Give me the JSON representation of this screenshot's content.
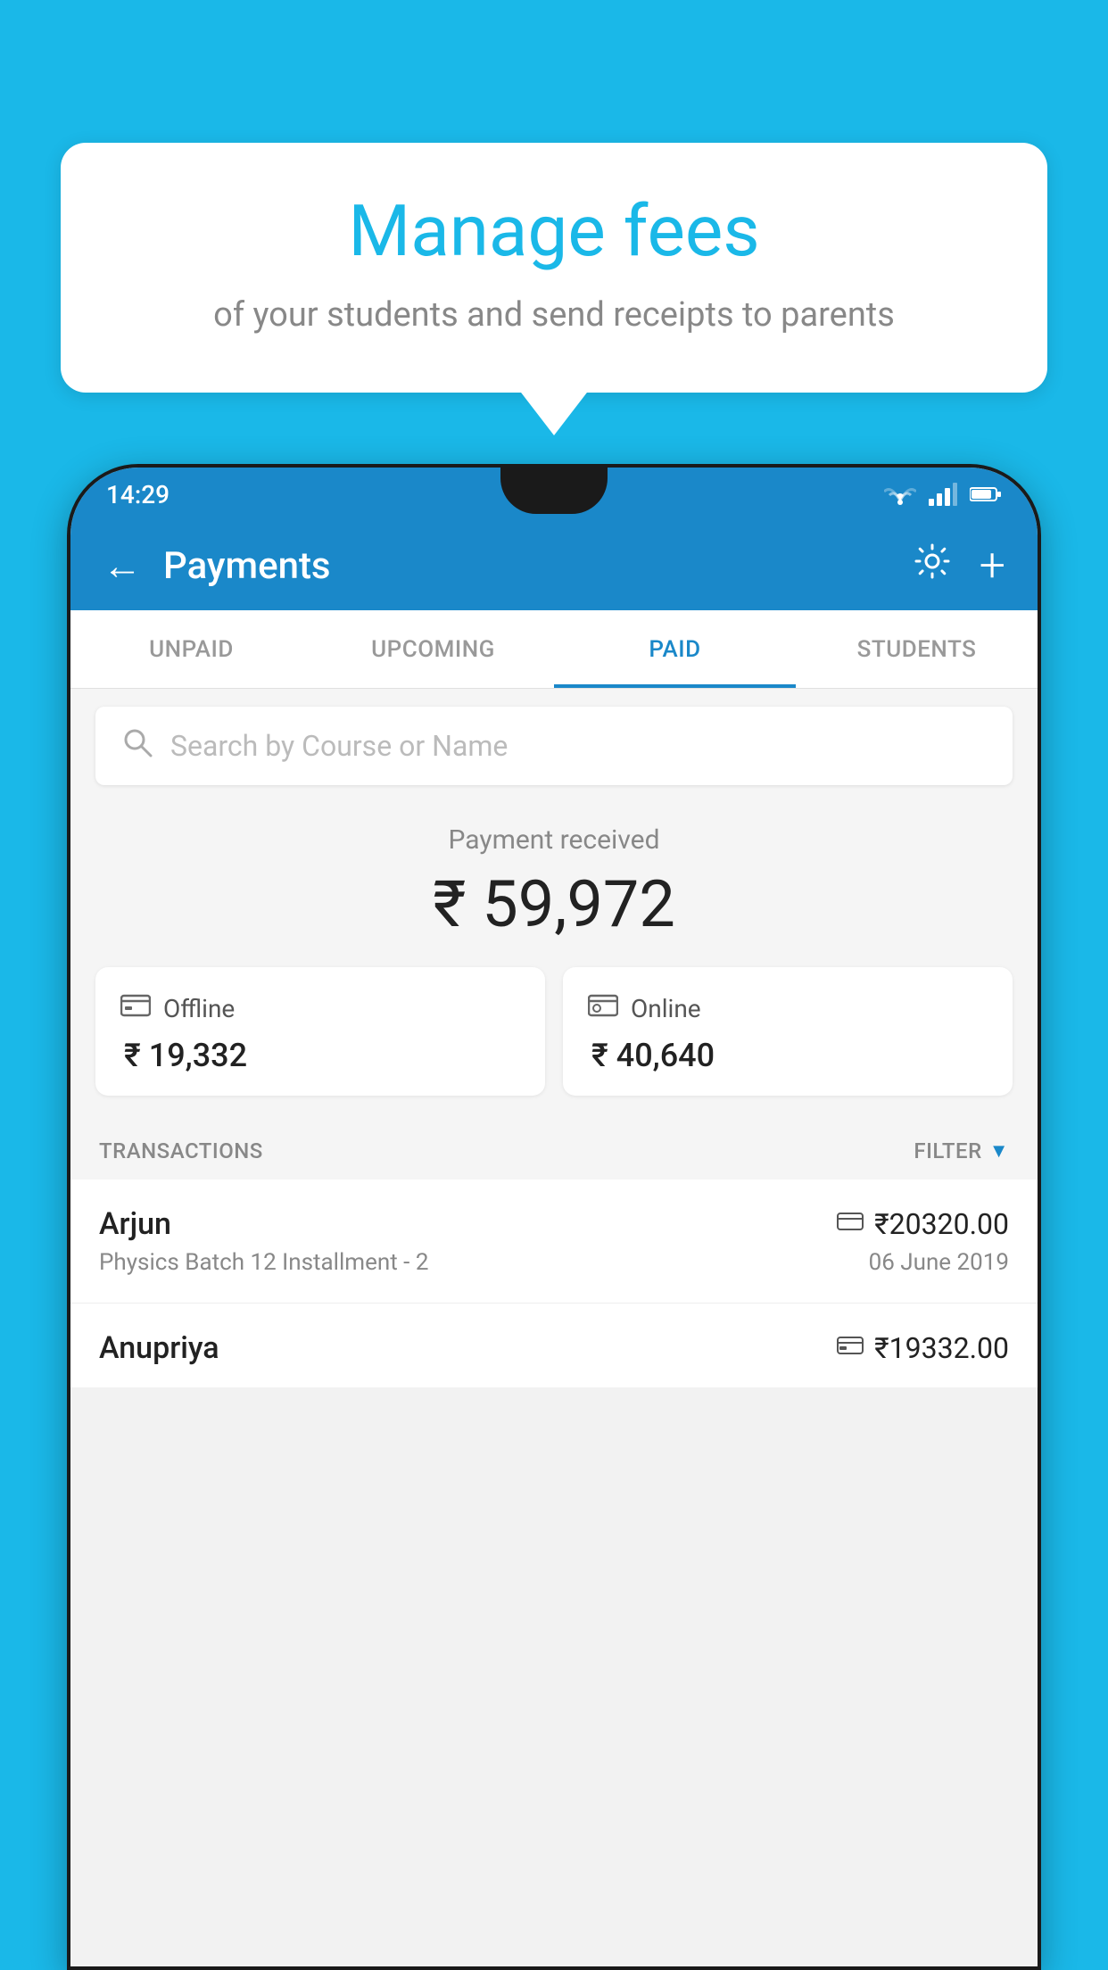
{
  "background_color": "#1ab8e8",
  "bubble": {
    "title": "Manage fees",
    "subtitle": "of your students and send receipts to parents"
  },
  "status_bar": {
    "time": "14:29"
  },
  "header": {
    "title": "Payments",
    "back_label": "←",
    "gear_label": "⚙",
    "plus_label": "+"
  },
  "tabs": [
    {
      "label": "UNPAID",
      "active": false
    },
    {
      "label": "UPCOMING",
      "active": false
    },
    {
      "label": "PAID",
      "active": true
    },
    {
      "label": "STUDENTS",
      "active": false
    }
  ],
  "search": {
    "placeholder": "Search by Course or Name"
  },
  "payment_summary": {
    "label": "Payment received",
    "amount": "₹ 59,972"
  },
  "payment_cards": [
    {
      "type": "Offline",
      "amount": "₹ 19,332",
      "icon": "offline"
    },
    {
      "type": "Online",
      "amount": "₹ 40,640",
      "icon": "online"
    }
  ],
  "transactions_section": {
    "label": "TRANSACTIONS",
    "filter_label": "FILTER"
  },
  "transactions": [
    {
      "name": "Arjun",
      "course": "Physics Batch 12 Installment - 2",
      "amount": "₹20320.00",
      "date": "06 June 2019",
      "payment_type": "online"
    },
    {
      "name": "Anupriya",
      "course": "",
      "amount": "₹19332.00",
      "date": "",
      "payment_type": "offline"
    }
  ]
}
